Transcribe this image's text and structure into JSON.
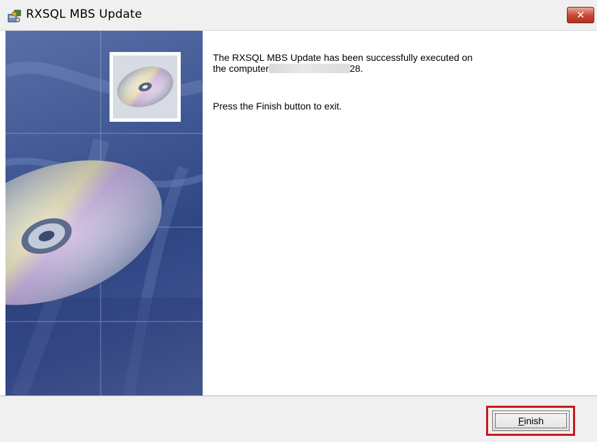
{
  "window": {
    "title": "RXSQL MBS Update",
    "close_icon": "close-icon"
  },
  "message": {
    "line1": "The RXSQL MBS Update has been successfully executed on",
    "line2_prefix": "the computer",
    "line2_suffix": "28.",
    "line3": "Press the Finish button to exit."
  },
  "footer": {
    "finish_mnemonic": "F",
    "finish_rest": "inish"
  },
  "colors": {
    "close_button": "#c8452f",
    "highlight_border": "#c8171d",
    "art_background": "#3f5793"
  }
}
